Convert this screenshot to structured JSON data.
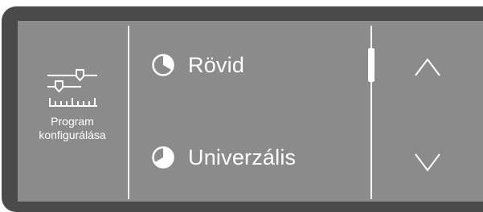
{
  "config": {
    "label_line1": "Program",
    "label_line2": "konfigurálása",
    "icon": "program-config-sliders-icon"
  },
  "options": [
    {
      "label": "Rövid",
      "icon": "short-program-clock-icon"
    },
    {
      "label": "Univerzális",
      "icon": "universal-program-clock-icon"
    }
  ],
  "scroll": {
    "up_icon": "chevron-up-icon",
    "down_icon": "chevron-down-icon"
  },
  "colors": {
    "screen_background": "#8b8b8b",
    "bezel": "#4a4a4a",
    "foreground": "#ffffff"
  }
}
